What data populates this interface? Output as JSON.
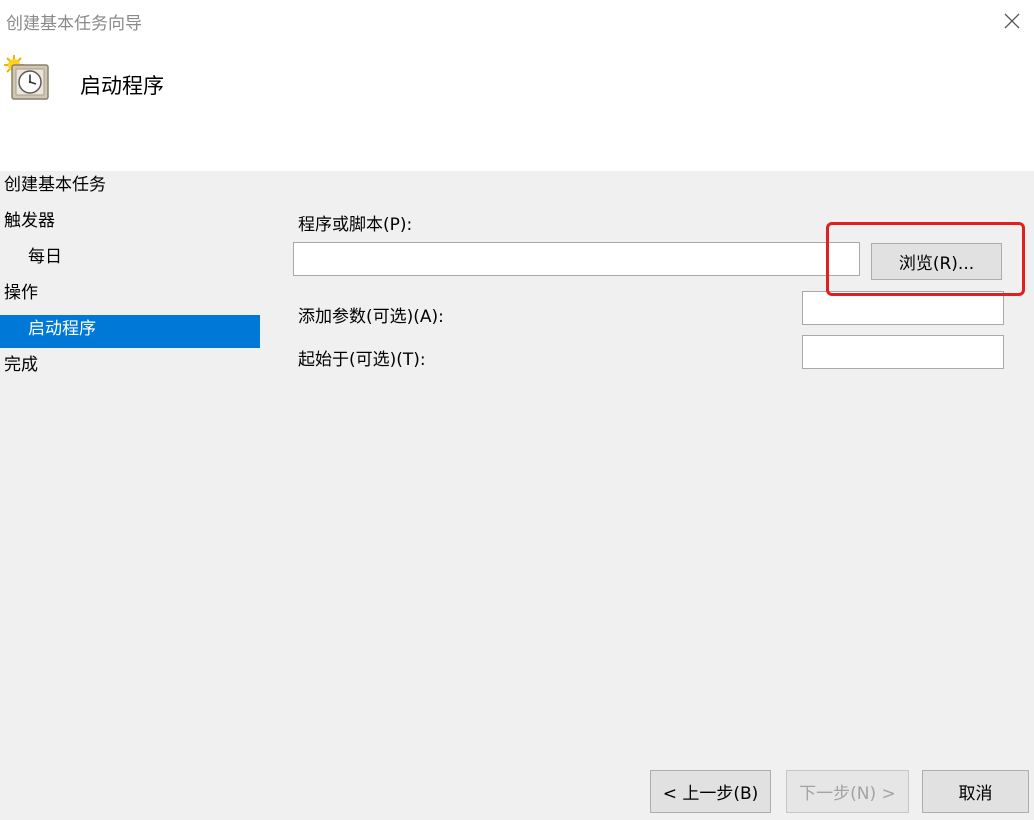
{
  "window": {
    "title": "创建基本任务向导",
    "close_icon": "close-icon"
  },
  "header": {
    "icon": "task-scheduler-clock-icon",
    "title": "启动程序"
  },
  "sidebar": {
    "items": [
      {
        "label": "创建基本任务",
        "level": 0,
        "selected": false
      },
      {
        "label": "触发器",
        "level": 0,
        "selected": false
      },
      {
        "label": "每日",
        "level": 1,
        "selected": false
      },
      {
        "label": "操作",
        "level": 0,
        "selected": false
      },
      {
        "label": "启动程序",
        "level": 1,
        "selected": true
      },
      {
        "label": "完成",
        "level": 0,
        "selected": false
      }
    ]
  },
  "form": {
    "program_label": "程序或脚本(P):",
    "program_value": "",
    "browse_label": "浏览(R)...",
    "args_label": "添加参数(可选)(A):",
    "args_value": "",
    "start_in_label": "起始于(可选)(T):",
    "start_in_value": ""
  },
  "footer": {
    "back_label": "< 上一步(B)",
    "next_label": "下一步(N) >",
    "cancel_label": "取消"
  },
  "colors": {
    "selection": "#0078d7",
    "highlight": "#e02020",
    "panel": "#f0f0f0"
  }
}
